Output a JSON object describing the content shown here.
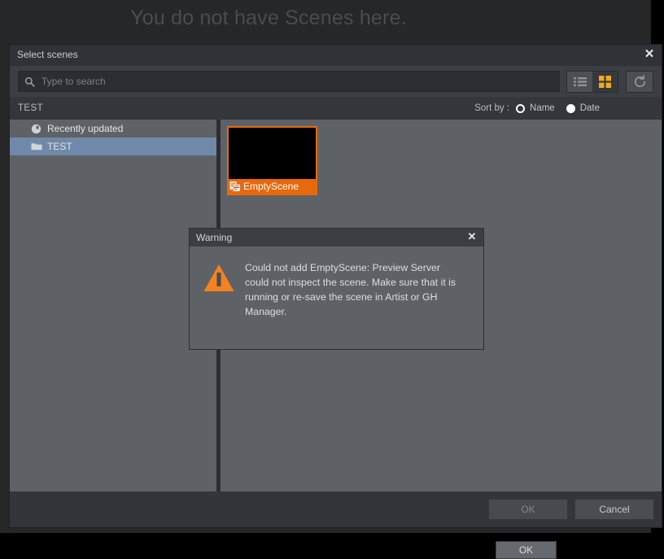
{
  "background": {
    "empty_message": "You do not have Scenes here."
  },
  "dialog": {
    "title": "Select scenes",
    "close_icon": "close-icon",
    "toolbar": {
      "search_icon": "search-icon",
      "search_value": "",
      "search_placeholder": "Type to search",
      "list_view_icon": "list-view-icon",
      "grid_view_icon": "grid-view-icon",
      "refresh_icon": "refresh-icon",
      "active_view": "grid"
    },
    "subheader": {
      "current_folder": "TEST",
      "sort_by_label": "Sort by :",
      "sort_options": [
        {
          "label": "Name",
          "selected": true
        },
        {
          "label": "Date",
          "selected": false
        }
      ]
    },
    "sidebar": {
      "items": [
        {
          "label": "Recently updated",
          "icon": "clock-icon",
          "selected": false
        },
        {
          "label": "TEST",
          "icon": "folder-icon",
          "selected": true
        }
      ]
    },
    "scenes": [
      {
        "name": "EmptyScene",
        "icon": "scene-file-icon",
        "selected": true
      }
    ],
    "footer": {
      "ok_label": "OK",
      "cancel_label": "Cancel",
      "ok_disabled": true
    }
  },
  "warning_dialog": {
    "title": "Warning",
    "close_icon": "close-icon",
    "icon": "warning-triangle-icon",
    "message": "Could not add EmptyScene: Preview Server could not inspect the scene. Make sure that it is running or re-save the scene in Artist or GH Manager.",
    "ok_label": "OK"
  },
  "colors": {
    "accent_orange": "#e8690a",
    "selection_blue": "#7189a8",
    "panel_gray": "#5e6266",
    "dialog_bg": "#3b3e42",
    "app_bg": "#262729"
  }
}
